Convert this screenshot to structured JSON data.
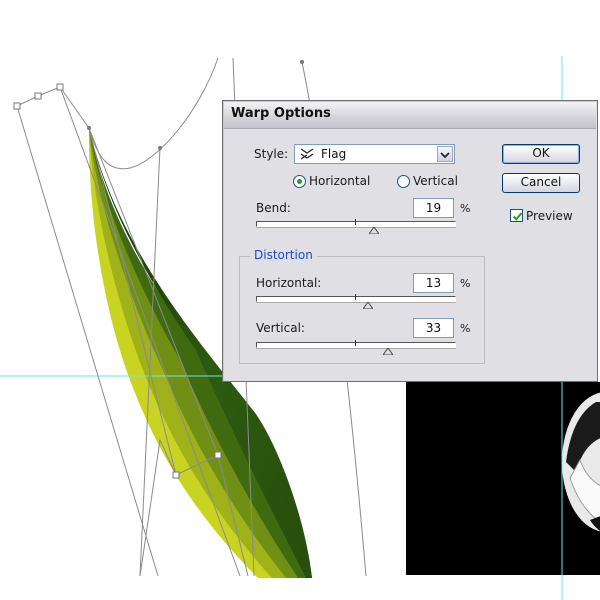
{
  "dialog": {
    "title": "Warp Options",
    "style_label": "Style:",
    "style_value": "Flag",
    "style_icon": "flag-warp-icon",
    "orientation": {
      "horizontal_label": "Horizontal",
      "vertical_label": "Vertical",
      "selected": "Horizontal"
    },
    "bend": {
      "label": "Bend:",
      "value": "19",
      "unit": "%",
      "slider_percent": 19
    },
    "distortion": {
      "group_label": "Distortion",
      "horizontal": {
        "label": "Horizontal:",
        "value": "13",
        "unit": "%",
        "slider_percent": 13
      },
      "vertical": {
        "label": "Vertical:",
        "value": "33",
        "unit": "%",
        "slider_percent": 33
      }
    },
    "buttons": {
      "ok": "OK",
      "cancel": "Cancel"
    },
    "preview": {
      "label": "Preview",
      "checked": true
    }
  },
  "colors": {
    "guide": "#6ee6e8",
    "leaf_dark": "#173d08",
    "leaf_light": "#c8d620",
    "dialog_bg": "#e0dfe3",
    "accent_blue": "#1f4bcc"
  }
}
